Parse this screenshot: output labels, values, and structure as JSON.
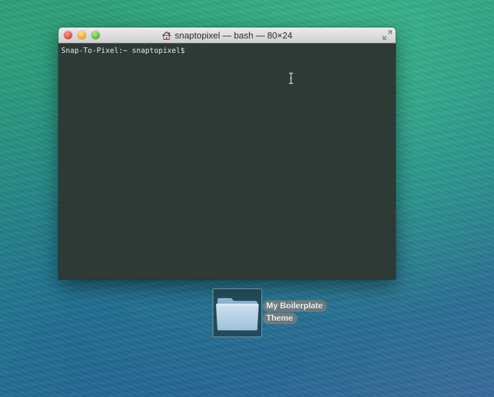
{
  "window": {
    "title": "snaptopixel — bash — 80×24",
    "home_icon": "home-icon",
    "fullscreen_icon": "fullscreen-arrows-icon",
    "buttons": [
      "close",
      "minimize",
      "zoom"
    ]
  },
  "terminal": {
    "prompt": "Snap-To-Pixel:~ snaptopixel$",
    "background_color": "#2e3a35",
    "text_color": "#e6ece9",
    "cursor_icon": "ibeam-cursor-icon"
  },
  "desktop": {
    "folder": {
      "icon": "folder-icon",
      "label_lines": [
        "My Boilerplate",
        "Theme"
      ]
    }
  },
  "colors": {
    "close": "#f1594d",
    "minimize": "#f5bb36",
    "zoom": "#6fcb44"
  }
}
